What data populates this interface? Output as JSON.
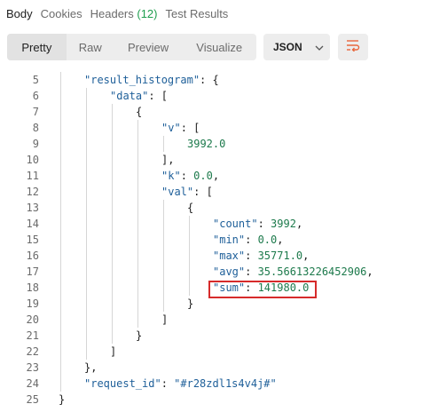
{
  "tabs": [
    {
      "label": "Body",
      "active": true
    },
    {
      "label": "Cookies",
      "active": false
    },
    {
      "label": "Headers",
      "count": "(12)",
      "active": false
    },
    {
      "label": "Test Results",
      "active": false
    }
  ],
  "toolbar": {
    "view_modes": [
      "Pretty",
      "Raw",
      "Preview",
      "Visualize"
    ],
    "active_view": "Pretty",
    "language": "JSON",
    "language_icon": "chevron-down-icon",
    "wrap_icon": "wrap-lines-icon",
    "accent_color": "#e8663d"
  },
  "code_lines": [
    {
      "num": "5",
      "indent": 1,
      "tokens": [
        [
          "s",
          "\"result_histogram\""
        ],
        [
          "p",
          ": {"
        ]
      ]
    },
    {
      "num": "6",
      "indent": 2,
      "tokens": [
        [
          "s",
          "\"data\""
        ],
        [
          "p",
          ": ["
        ]
      ]
    },
    {
      "num": "7",
      "indent": 3,
      "tokens": [
        [
          "p",
          "{"
        ]
      ]
    },
    {
      "num": "8",
      "indent": 4,
      "tokens": [
        [
          "s",
          "\"v\""
        ],
        [
          "p",
          ": ["
        ]
      ]
    },
    {
      "num": "9",
      "indent": 5,
      "tokens": [
        [
          "n",
          "3992.0"
        ]
      ]
    },
    {
      "num": "10",
      "indent": 4,
      "tokens": [
        [
          "p",
          "],"
        ]
      ]
    },
    {
      "num": "11",
      "indent": 4,
      "tokens": [
        [
          "s",
          "\"k\""
        ],
        [
          "p",
          ": "
        ],
        [
          "n",
          "0.0"
        ],
        [
          "p",
          ","
        ]
      ]
    },
    {
      "num": "12",
      "indent": 4,
      "tokens": [
        [
          "s",
          "\"val\""
        ],
        [
          "p",
          ": ["
        ]
      ]
    },
    {
      "num": "13",
      "indent": 5,
      "tokens": [
        [
          "p",
          "{"
        ]
      ]
    },
    {
      "num": "14",
      "indent": 6,
      "tokens": [
        [
          "s",
          "\"count\""
        ],
        [
          "p",
          ": "
        ],
        [
          "n",
          "3992"
        ],
        [
          "p",
          ","
        ]
      ]
    },
    {
      "num": "15",
      "indent": 6,
      "tokens": [
        [
          "s",
          "\"min\""
        ],
        [
          "p",
          ": "
        ],
        [
          "n",
          "0.0"
        ],
        [
          "p",
          ","
        ]
      ]
    },
    {
      "num": "16",
      "indent": 6,
      "tokens": [
        [
          "s",
          "\"max\""
        ],
        [
          "p",
          ": "
        ],
        [
          "n",
          "35771.0"
        ],
        [
          "p",
          ","
        ]
      ]
    },
    {
      "num": "17",
      "indent": 6,
      "tokens": [
        [
          "s",
          "\"avg\""
        ],
        [
          "p",
          ": "
        ],
        [
          "n",
          "35.56613226452906"
        ],
        [
          "p",
          ","
        ]
      ]
    },
    {
      "num": "18",
      "indent": 6,
      "tokens": [
        [
          "s",
          "\"sum\""
        ],
        [
          "p",
          ": "
        ],
        [
          "n",
          "141980.0"
        ]
      ]
    },
    {
      "num": "19",
      "indent": 5,
      "tokens": [
        [
          "p",
          "}"
        ]
      ]
    },
    {
      "num": "20",
      "indent": 4,
      "tokens": [
        [
          "p",
          "]"
        ]
      ]
    },
    {
      "num": "21",
      "indent": 3,
      "tokens": [
        [
          "p",
          "}"
        ]
      ]
    },
    {
      "num": "22",
      "indent": 2,
      "tokens": [
        [
          "p",
          "]"
        ]
      ]
    },
    {
      "num": "23",
      "indent": 1,
      "tokens": [
        [
          "p",
          "},"
        ]
      ]
    },
    {
      "num": "24",
      "indent": 1,
      "tokens": [
        [
          "s",
          "\"request_id\""
        ],
        [
          "p",
          ": "
        ],
        [
          "s",
          "\"#r28zdl1s4v4j#\""
        ]
      ]
    },
    {
      "num": "25",
      "indent": 0,
      "tokens": [
        [
          "p",
          "}"
        ]
      ]
    }
  ],
  "annotation": {
    "highlight_line": "18",
    "highlight_color": "#d62b2b"
  }
}
